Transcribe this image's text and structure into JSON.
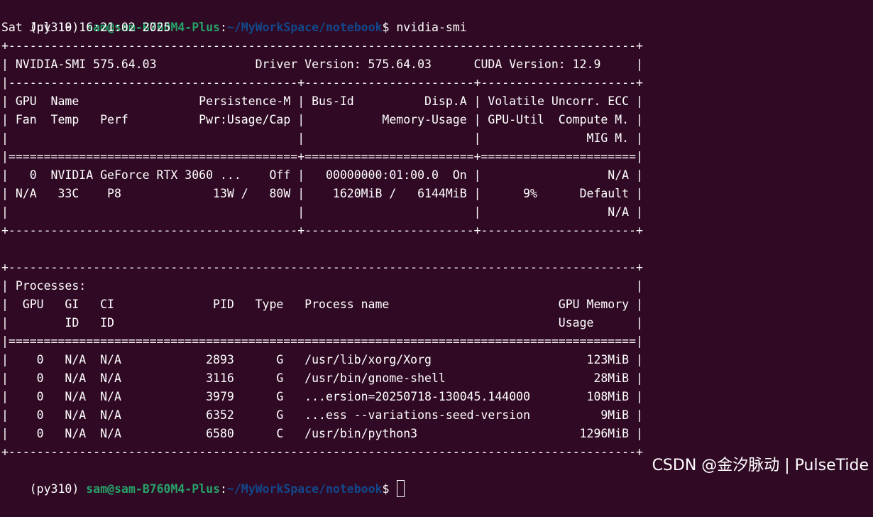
{
  "prompt": {
    "env": "(py310)",
    "user_host": "sam@sam-B760M4-Plus",
    "colon": ":",
    "path": "~/MyWorkSpace/notebook",
    "dollar": "$"
  },
  "command": "nvidia-smi",
  "output_lines": [
    "Sat Jul 19 16:21:02 2025",
    "+-----------------------------------------------------------------------------------------+",
    "| NVIDIA-SMI 575.64.03              Driver Version: 575.64.03      CUDA Version: 12.9     |",
    "|-----------------------------------------+------------------------+----------------------+",
    "| GPU  Name                 Persistence-M | Bus-Id          Disp.A | Volatile Uncorr. ECC |",
    "| Fan  Temp   Perf          Pwr:Usage/Cap |           Memory-Usage | GPU-Util  Compute M. |",
    "|                                         |                        |               MIG M. |",
    "|=========================================+========================+======================|",
    "|   0  NVIDIA GeForce RTX 3060 ...    Off |   00000000:01:00.0  On |                  N/A |",
    "| N/A   33C    P8             13W /   80W |    1620MiB /   6144MiB |      9%      Default |",
    "|                                         |                        |                  N/A |",
    "+-----------------------------------------+------------------------+----------------------+",
    "",
    "+-----------------------------------------------------------------------------------------+",
    "| Processes:                                                                              |",
    "|  GPU   GI   CI              PID   Type   Process name                        GPU Memory |",
    "|        ID   ID                                                               Usage      |",
    "|=========================================================================================|",
    "|    0   N/A  N/A            2893      G   /usr/lib/xorg/Xorg                      123MiB |",
    "|    0   N/A  N/A            3116      G   /usr/bin/gnome-shell                     28MiB |",
    "|    0   N/A  N/A            3979      G   ...ersion=20250718-130045.144000        108MiB |",
    "|    0   N/A  N/A            6352      G   ...ess --variations-seed-version          9MiB |",
    "|    0   N/A  N/A            6580      C   /usr/bin/python3                       1296MiB |",
    "+-----------------------------------------------------------------------------------------+"
  ],
  "watermark": "CSDN @金汐脉动 | PulseTide",
  "colors": {
    "background": "#300a24",
    "text": "#ffffff",
    "user_host": "#26a269",
    "path": "#12488b"
  }
}
